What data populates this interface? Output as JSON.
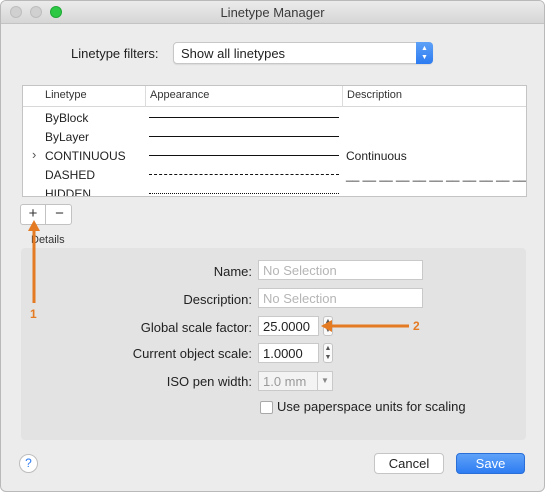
{
  "window": {
    "title": "Linetype Manager"
  },
  "filter": {
    "label": "Linetype filters:",
    "value": "Show all linetypes"
  },
  "table": {
    "headers": [
      "Linetype",
      "Appearance",
      "Description"
    ],
    "rows": [
      {
        "name": "ByBlock",
        "description": "",
        "appearance": "solid"
      },
      {
        "name": "ByLayer",
        "description": "",
        "appearance": "solid"
      },
      {
        "name": "CONTINUOUS",
        "description": "Continuous",
        "appearance": "solid",
        "current": true
      },
      {
        "name": "DASHED",
        "description": "__ __ __ __ __ __ __ __ __ __ __ __...",
        "appearance": "dashed"
      },
      {
        "name": "HIDDEN",
        "description": "",
        "appearance": "hidden"
      }
    ]
  },
  "buttons": {
    "add": "+",
    "remove": "−",
    "cancel": "Cancel",
    "save": "Save",
    "help": "?"
  },
  "details": {
    "label": "Details",
    "name_label": "Name:",
    "name_placeholder": "No Selection",
    "description_label": "Description:",
    "description_placeholder": "No Selection",
    "global_scale_label": "Global scale factor:",
    "global_scale_value": "25.0000",
    "current_scale_label": "Current object scale:",
    "current_scale_value": "1.0000",
    "iso_pen_label": "ISO pen width:",
    "iso_pen_value": "1.0 mm",
    "paperspace_label": "Use paperspace units for scaling"
  },
  "annotations": {
    "one": "1",
    "two": "2"
  },
  "colors": {
    "accent": "#2c7bf1",
    "annotation": "#e47a22"
  }
}
